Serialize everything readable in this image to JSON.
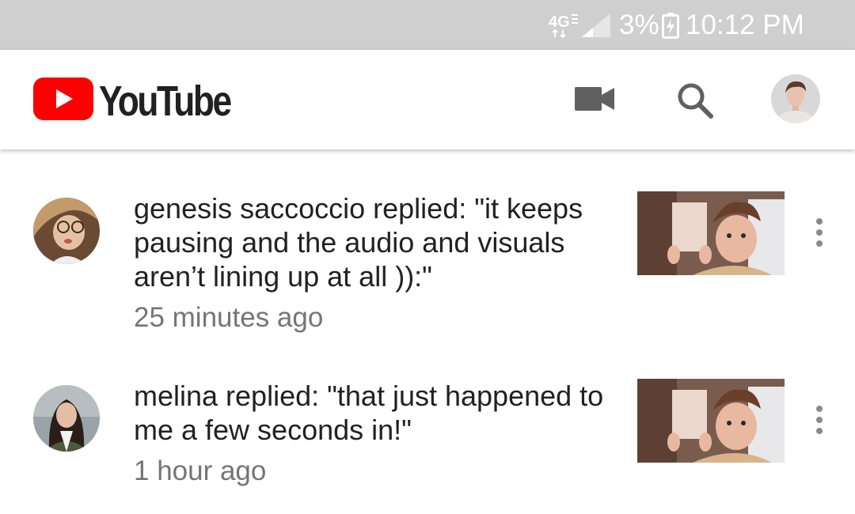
{
  "status_bar": {
    "network": "4G",
    "battery_percent": "3%",
    "time": "10:12 PM"
  },
  "app_bar": {
    "title": "YouTube",
    "icons": [
      "video-camera-icon",
      "search-icon",
      "account-avatar"
    ]
  },
  "notifications": [
    {
      "text": "genesis saccoccio replied: \"it keeps pausing and the audio and visuals aren’t lining up at all )):\"",
      "time": "25 minutes ago"
    },
    {
      "text": "melina replied: \"that just happened to me a few seconds in!\"",
      "time": "1 hour ago"
    }
  ],
  "colors": {
    "status_bar_bg": "#cfcfcf",
    "youtube_red": "#ff0000",
    "text_primary": "#212121",
    "text_secondary": "#757575",
    "icon_gray": "#606060"
  }
}
